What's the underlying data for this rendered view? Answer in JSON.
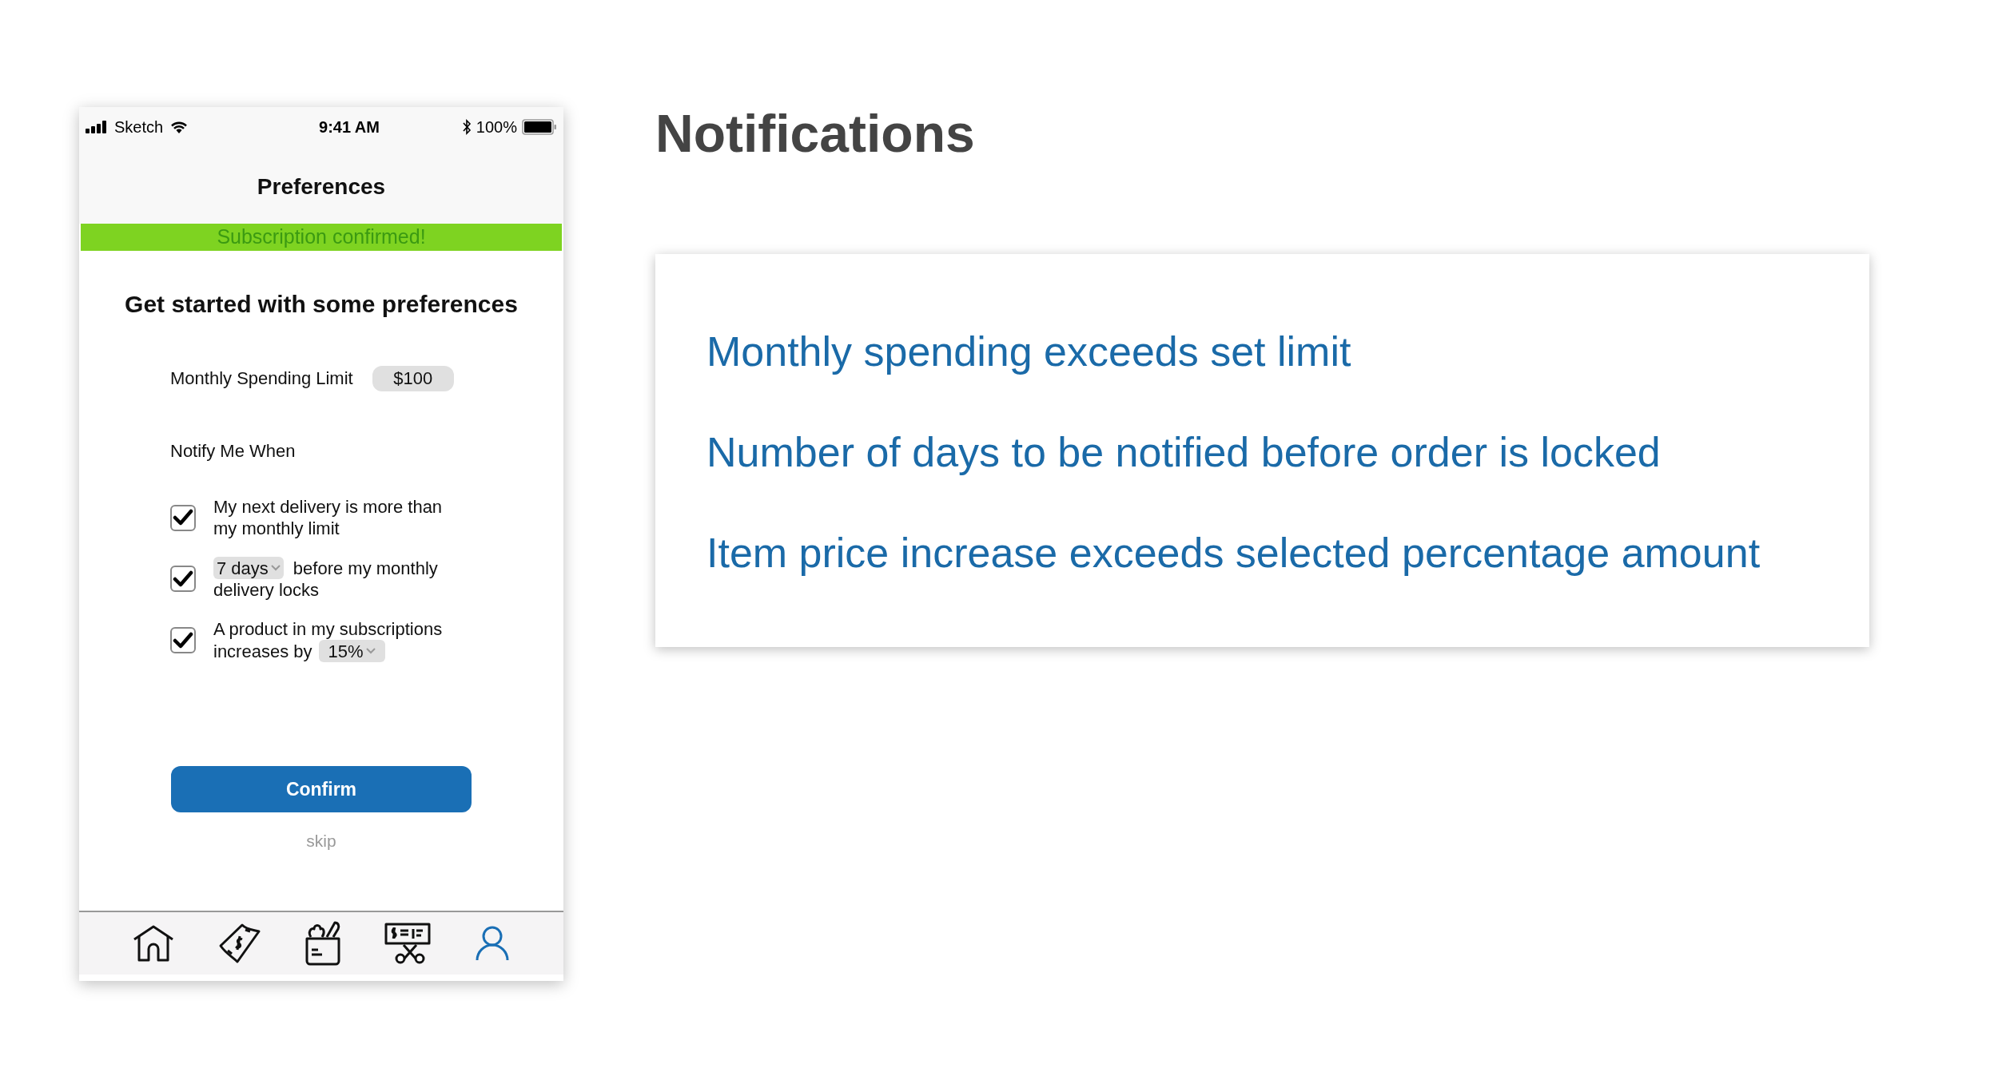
{
  "status_bar": {
    "carrier": "Sketch",
    "time": "9:41 AM",
    "battery": "100%"
  },
  "nav_title": "Preferences",
  "banner": "Subscription confirmed!",
  "heading": "Get started with some preferences",
  "spending_limit": {
    "label": "Monthly Spending Limit",
    "value": "$100"
  },
  "notify_label": "Notify Me When",
  "options": [
    {
      "kind": "text",
      "checked": true,
      "lines": [
        "My next delivery is more than",
        "my monthly limit"
      ]
    },
    {
      "kind": "dropdown_first",
      "checked": true,
      "dropdown": "7 days",
      "lines": [
        "before my monthly",
        "delivery locks"
      ]
    },
    {
      "kind": "dropdown_last",
      "checked": true,
      "lines": [
        "A product in my subscriptions",
        "increases by"
      ],
      "dropdown": "15%"
    }
  ],
  "confirm_button": "Confirm",
  "skip_link": "skip",
  "tab_bar": [
    {
      "kind": "home",
      "selected": false
    },
    {
      "kind": "money",
      "selected": false
    },
    {
      "kind": "groceries",
      "selected": false
    },
    {
      "kind": "coupon",
      "selected": false
    },
    {
      "kind": "profile",
      "selected": true
    }
  ],
  "notifications": {
    "title": "Notifications",
    "items": [
      "Monthly spending exceeds set limit",
      "Number of days to be notified before order is locked",
      "Item price increase exceeds selected percentage amount"
    ]
  }
}
